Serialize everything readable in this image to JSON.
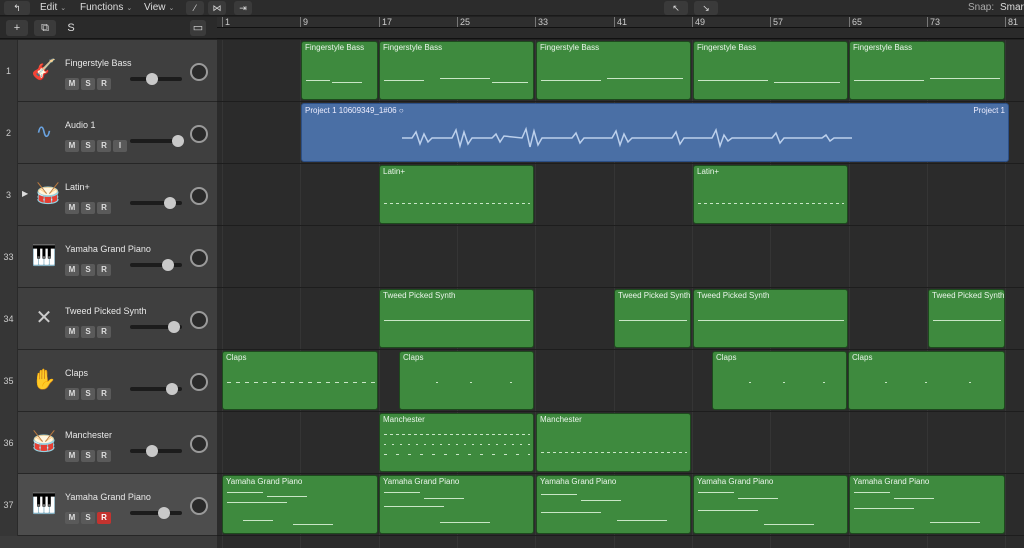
{
  "menu": {
    "edit": "Edit",
    "functions": "Functions",
    "view": "View",
    "snap_label": "Snap:",
    "snap_value": "Smart"
  },
  "header_toolbar": {
    "add": "+",
    "solo": "S"
  },
  "ruler": [
    "1",
    "9",
    "17",
    "25",
    "33",
    "41",
    "49",
    "57",
    "65",
    "73",
    "81"
  ],
  "tracks": [
    {
      "number": "1",
      "name": "Fingerstyle Bass",
      "icon": "bass-guitar-icon",
      "buttons": [
        "M",
        "S",
        "R"
      ]
    },
    {
      "number": "2",
      "name": "Audio 1",
      "icon": "audio-waveform-icon",
      "buttons": [
        "M",
        "S",
        "R",
        "I"
      ]
    },
    {
      "number": "3",
      "name": "Latin+",
      "icon": "percussion-icon",
      "buttons": [
        "M",
        "S",
        "R"
      ]
    },
    {
      "number": "33",
      "name": "Yamaha Grand Piano",
      "icon": "grand-piano-icon",
      "buttons": [
        "M",
        "S",
        "R"
      ]
    },
    {
      "number": "34",
      "name": "Tweed Picked Synth",
      "icon": "synth-icon",
      "buttons": [
        "M",
        "S",
        "R"
      ]
    },
    {
      "number": "35",
      "name": "Claps",
      "icon": "hand-clap-icon",
      "buttons": [
        "M",
        "S",
        "R"
      ]
    },
    {
      "number": "36",
      "name": "Manchester",
      "icon": "drum-kit-icon",
      "buttons": [
        "M",
        "S",
        "R"
      ]
    },
    {
      "number": "37",
      "name": "Yamaha Grand Piano",
      "icon": "grand-piano-icon",
      "buttons": [
        "M",
        "S",
        "R"
      ]
    }
  ],
  "regions": {
    "bass": "Fingerstyle Bass",
    "audio_left": "Project 1 10609349_1#06",
    "audio_right": "Project 1",
    "latin": "Latin+",
    "synth": "Tweed Picked Synth",
    "claps": "Claps",
    "manchester": "Manchester",
    "piano": "Yamaha Grand Piano"
  },
  "colors": {
    "midi_region": "#3e8a3e",
    "audio_region": "#4a6fa5",
    "record_armed": "#c4332f"
  }
}
